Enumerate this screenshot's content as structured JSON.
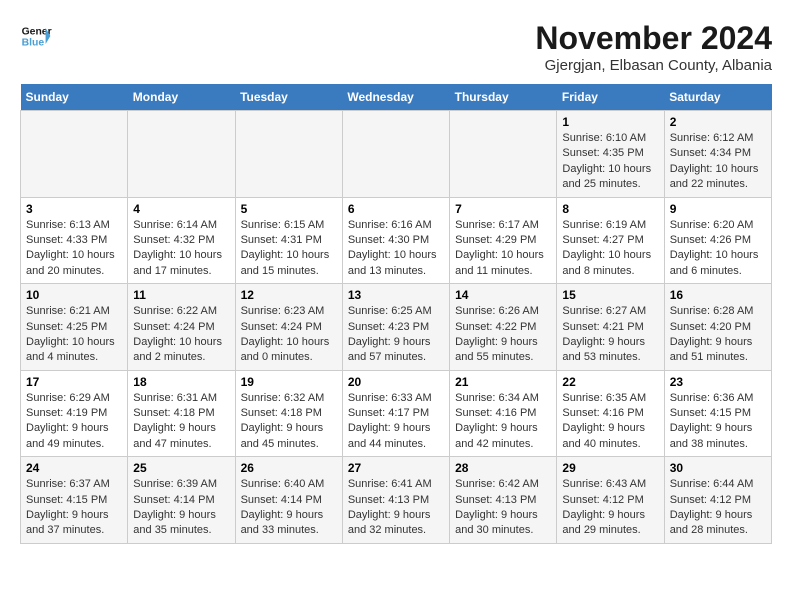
{
  "logo": {
    "line1": "General",
    "line2": "Blue"
  },
  "title": "November 2024",
  "subtitle": "Gjergjan, Elbasan County, Albania",
  "weekdays": [
    "Sunday",
    "Monday",
    "Tuesday",
    "Wednesday",
    "Thursday",
    "Friday",
    "Saturday"
  ],
  "weeks": [
    [
      {
        "day": "",
        "detail": ""
      },
      {
        "day": "",
        "detail": ""
      },
      {
        "day": "",
        "detail": ""
      },
      {
        "day": "",
        "detail": ""
      },
      {
        "day": "",
        "detail": ""
      },
      {
        "day": "1",
        "detail": "Sunrise: 6:10 AM\nSunset: 4:35 PM\nDaylight: 10 hours\nand 25 minutes."
      },
      {
        "day": "2",
        "detail": "Sunrise: 6:12 AM\nSunset: 4:34 PM\nDaylight: 10 hours\nand 22 minutes."
      }
    ],
    [
      {
        "day": "3",
        "detail": "Sunrise: 6:13 AM\nSunset: 4:33 PM\nDaylight: 10 hours\nand 20 minutes."
      },
      {
        "day": "4",
        "detail": "Sunrise: 6:14 AM\nSunset: 4:32 PM\nDaylight: 10 hours\nand 17 minutes."
      },
      {
        "day": "5",
        "detail": "Sunrise: 6:15 AM\nSunset: 4:31 PM\nDaylight: 10 hours\nand 15 minutes."
      },
      {
        "day": "6",
        "detail": "Sunrise: 6:16 AM\nSunset: 4:30 PM\nDaylight: 10 hours\nand 13 minutes."
      },
      {
        "day": "7",
        "detail": "Sunrise: 6:17 AM\nSunset: 4:29 PM\nDaylight: 10 hours\nand 11 minutes."
      },
      {
        "day": "8",
        "detail": "Sunrise: 6:19 AM\nSunset: 4:27 PM\nDaylight: 10 hours\nand 8 minutes."
      },
      {
        "day": "9",
        "detail": "Sunrise: 6:20 AM\nSunset: 4:26 PM\nDaylight: 10 hours\nand 6 minutes."
      }
    ],
    [
      {
        "day": "10",
        "detail": "Sunrise: 6:21 AM\nSunset: 4:25 PM\nDaylight: 10 hours\nand 4 minutes."
      },
      {
        "day": "11",
        "detail": "Sunrise: 6:22 AM\nSunset: 4:24 PM\nDaylight: 10 hours\nand 2 minutes."
      },
      {
        "day": "12",
        "detail": "Sunrise: 6:23 AM\nSunset: 4:24 PM\nDaylight: 10 hours\nand 0 minutes."
      },
      {
        "day": "13",
        "detail": "Sunrise: 6:25 AM\nSunset: 4:23 PM\nDaylight: 9 hours\nand 57 minutes."
      },
      {
        "day": "14",
        "detail": "Sunrise: 6:26 AM\nSunset: 4:22 PM\nDaylight: 9 hours\nand 55 minutes."
      },
      {
        "day": "15",
        "detail": "Sunrise: 6:27 AM\nSunset: 4:21 PM\nDaylight: 9 hours\nand 53 minutes."
      },
      {
        "day": "16",
        "detail": "Sunrise: 6:28 AM\nSunset: 4:20 PM\nDaylight: 9 hours\nand 51 minutes."
      }
    ],
    [
      {
        "day": "17",
        "detail": "Sunrise: 6:29 AM\nSunset: 4:19 PM\nDaylight: 9 hours\nand 49 minutes."
      },
      {
        "day": "18",
        "detail": "Sunrise: 6:31 AM\nSunset: 4:18 PM\nDaylight: 9 hours\nand 47 minutes."
      },
      {
        "day": "19",
        "detail": "Sunrise: 6:32 AM\nSunset: 4:18 PM\nDaylight: 9 hours\nand 45 minutes."
      },
      {
        "day": "20",
        "detail": "Sunrise: 6:33 AM\nSunset: 4:17 PM\nDaylight: 9 hours\nand 44 minutes."
      },
      {
        "day": "21",
        "detail": "Sunrise: 6:34 AM\nSunset: 4:16 PM\nDaylight: 9 hours\nand 42 minutes."
      },
      {
        "day": "22",
        "detail": "Sunrise: 6:35 AM\nSunset: 4:16 PM\nDaylight: 9 hours\nand 40 minutes."
      },
      {
        "day": "23",
        "detail": "Sunrise: 6:36 AM\nSunset: 4:15 PM\nDaylight: 9 hours\nand 38 minutes."
      }
    ],
    [
      {
        "day": "24",
        "detail": "Sunrise: 6:37 AM\nSunset: 4:15 PM\nDaylight: 9 hours\nand 37 minutes."
      },
      {
        "day": "25",
        "detail": "Sunrise: 6:39 AM\nSunset: 4:14 PM\nDaylight: 9 hours\nand 35 minutes."
      },
      {
        "day": "26",
        "detail": "Sunrise: 6:40 AM\nSunset: 4:14 PM\nDaylight: 9 hours\nand 33 minutes."
      },
      {
        "day": "27",
        "detail": "Sunrise: 6:41 AM\nSunset: 4:13 PM\nDaylight: 9 hours\nand 32 minutes."
      },
      {
        "day": "28",
        "detail": "Sunrise: 6:42 AM\nSunset: 4:13 PM\nDaylight: 9 hours\nand 30 minutes."
      },
      {
        "day": "29",
        "detail": "Sunrise: 6:43 AM\nSunset: 4:12 PM\nDaylight: 9 hours\nand 29 minutes."
      },
      {
        "day": "30",
        "detail": "Sunrise: 6:44 AM\nSunset: 4:12 PM\nDaylight: 9 hours\nand 28 minutes."
      }
    ]
  ]
}
